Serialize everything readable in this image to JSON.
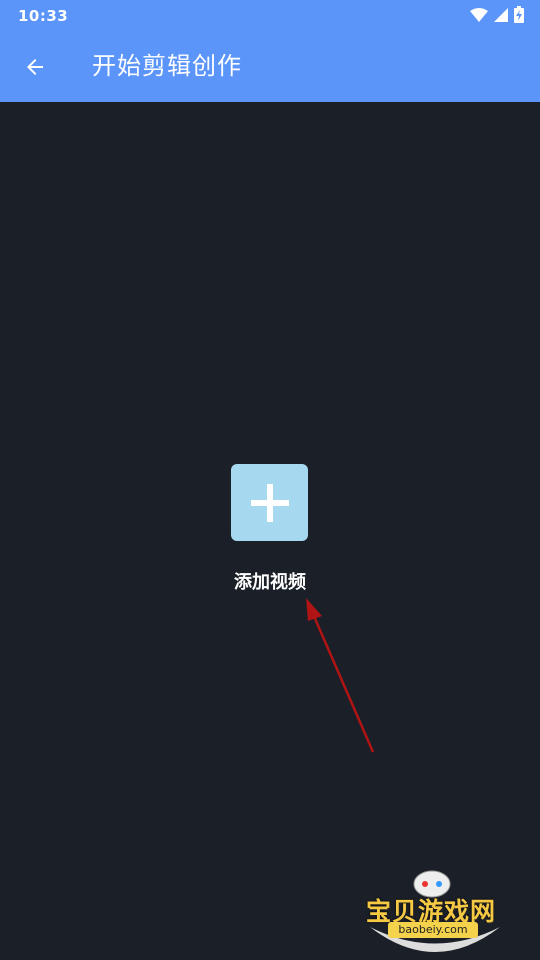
{
  "status_bar": {
    "time": "10:33"
  },
  "header": {
    "title": "开始剪辑创作"
  },
  "main": {
    "add_video_label": "添加视频"
  },
  "watermark": {
    "brand": "宝贝游戏网",
    "url": "baobeiy.com"
  },
  "colors": {
    "app_bar": "#5b95f9",
    "background": "#1b1f27",
    "add_tile": "#a6d8ef",
    "annotation_arrow": "#b01414"
  },
  "icons": {
    "back": "arrow-left-icon",
    "add": "plus-icon",
    "wifi": "wifi-icon",
    "signal": "signal-icon",
    "battery": "battery-charging-icon"
  }
}
